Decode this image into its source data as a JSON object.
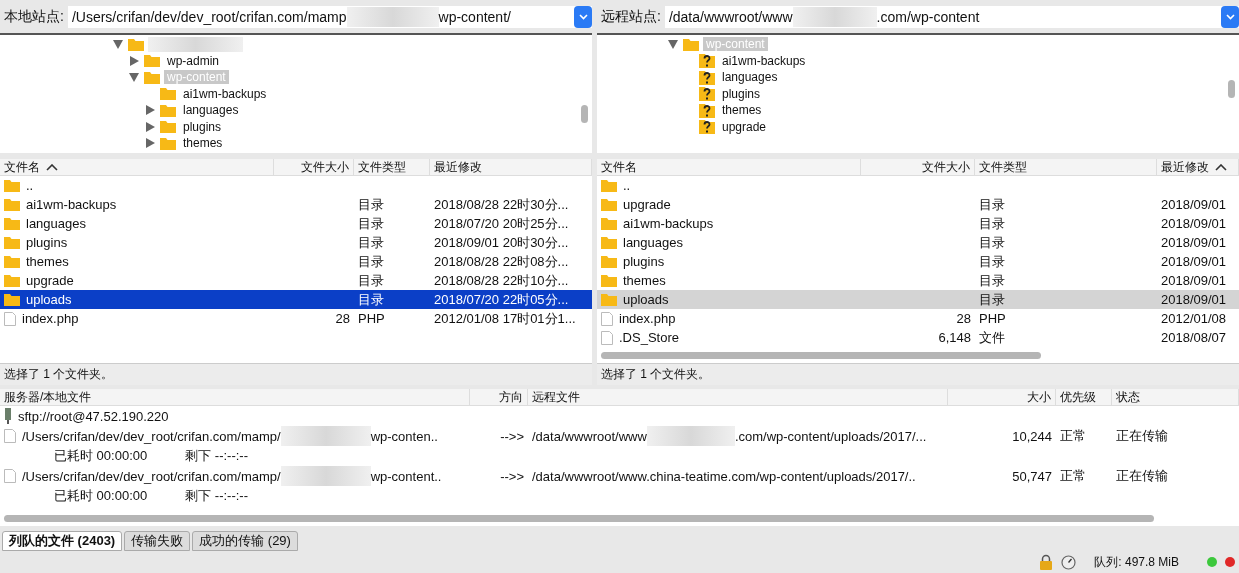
{
  "local": {
    "site_label": "本地站点:",
    "path": [
      {
        "kind": "text",
        "text": "/Users/crifan/dev/dev_root/crifan.com/mamp"
      },
      {
        "kind": "redacted"
      },
      {
        "kind": "text",
        "text": "wp-content/"
      }
    ],
    "tree": [
      {
        "kind": "redacted",
        "expanded": true,
        "children": [
          {
            "kind": "folder",
            "name": "wp-admin",
            "expanded": false,
            "selected": false
          },
          {
            "kind": "folder",
            "name": "wp-content",
            "expanded": true,
            "selected": true,
            "children": [
              {
                "kind": "leaf",
                "name": "ai1wm-backups",
                "selected": false
              },
              {
                "kind": "folder",
                "name": "languages",
                "expanded": false,
                "selected": false
              },
              {
                "kind": "folder",
                "name": "plugins",
                "expanded": false,
                "selected": false
              },
              {
                "kind": "folder",
                "name": "themes",
                "expanded": false,
                "selected": false
              }
            ]
          }
        ]
      }
    ],
    "focused": true,
    "columns": [
      {
        "label": "文件名",
        "sorted": true
      },
      {
        "label": "文件大小",
        "sorted": false
      },
      {
        "label": "文件类型",
        "sorted": false
      },
      {
        "label": "最近修改",
        "sorted": false
      }
    ],
    "rows": [
      {
        "kind": "folder",
        "name": "..",
        "selected": false
      },
      {
        "kind": "folder",
        "name": "ai1wm-backups",
        "type": "目录",
        "modified": "2018/08/28 22时30分...",
        "selected": false
      },
      {
        "kind": "folder",
        "name": "languages",
        "type": "目录",
        "modified": "2018/07/20 20时25分...",
        "selected": false
      },
      {
        "kind": "folder",
        "name": "plugins",
        "type": "目录",
        "modified": "2018/09/01 20时30分...",
        "selected": false
      },
      {
        "kind": "folder",
        "name": "themes",
        "type": "目录",
        "modified": "2018/08/28 22时08分...",
        "selected": false
      },
      {
        "kind": "folder",
        "name": "upgrade",
        "type": "目录",
        "modified": "2018/08/28 22时10分...",
        "selected": false
      },
      {
        "kind": "folder",
        "name": "uploads",
        "type": "目录",
        "modified": "2018/07/20 22时05分...",
        "selected": true
      },
      {
        "kind": "file",
        "name": "index.php",
        "size": "28",
        "type": "PHP",
        "modified": "2012/01/08 17时01分1...",
        "selected": false
      }
    ],
    "status": "选择了 1 个文件夹。"
  },
  "remote": {
    "site_label": "远程站点:",
    "path": [
      {
        "kind": "text",
        "text": "/data/wwwroot/www"
      },
      {
        "kind": "redacted"
      },
      {
        "kind": "text",
        "text": ".com/wp-content"
      }
    ],
    "tree": [
      {
        "kind": "folder",
        "name": "wp-content",
        "expanded": true,
        "selected": true,
        "children": [
          {
            "kind": "unknown",
            "name": "ai1wm-backups",
            "selected": false
          },
          {
            "kind": "unknown",
            "name": "languages",
            "selected": false
          },
          {
            "kind": "unknown",
            "name": "plugins",
            "selected": false
          },
          {
            "kind": "unknown",
            "name": "themes",
            "selected": false
          },
          {
            "kind": "unknown",
            "name": "upgrade",
            "selected": false
          }
        ]
      }
    ],
    "focused": false,
    "columns": [
      {
        "label": "文件名",
        "sorted": false
      },
      {
        "label": "文件大小",
        "sorted": false
      },
      {
        "label": "文件类型",
        "sorted": false
      },
      {
        "label": "最近修改",
        "sorted": true
      }
    ],
    "rows": [
      {
        "kind": "folder",
        "name": "..",
        "selected": false
      },
      {
        "kind": "folder",
        "name": "upgrade",
        "type": "目录",
        "modified": "2018/09/01",
        "selected": false
      },
      {
        "kind": "folder",
        "name": "ai1wm-backups",
        "type": "目录",
        "modified": "2018/09/01",
        "selected": false
      },
      {
        "kind": "folder",
        "name": "languages",
        "type": "目录",
        "modified": "2018/09/01",
        "selected": false
      },
      {
        "kind": "folder",
        "name": "plugins",
        "type": "目录",
        "modified": "2018/09/01",
        "selected": false
      },
      {
        "kind": "folder",
        "name": "themes",
        "type": "目录",
        "modified": "2018/09/01",
        "selected": false
      },
      {
        "kind": "folder",
        "name": "uploads",
        "type": "目录",
        "modified": "2018/09/01",
        "selected": true
      },
      {
        "kind": "file",
        "name": "index.php",
        "size": "28",
        "type": "PHP",
        "modified": "2012/01/08",
        "selected": false
      },
      {
        "kind": "file",
        "name": ".DS_Store",
        "size": "6,148",
        "type": "文件",
        "modified": "2018/08/07",
        "selected": false
      }
    ],
    "status": "选择了 1 个文件夹。"
  },
  "queue": {
    "columns": [
      "服务器/本地文件",
      "方向",
      "远程文件",
      "大小",
      "优先级",
      "状态"
    ],
    "server": "sftp://root@47.52.190.220",
    "transfers": [
      {
        "local": [
          {
            "kind": "text",
            "text": "/Users/crifan/dev/dev_root/crifan.com/mamp/"
          },
          {
            "kind": "redacted"
          },
          {
            "kind": "text",
            "text": "wp-conten.."
          }
        ],
        "direction": "-->>",
        "remote": [
          {
            "kind": "text",
            "text": "/data/wwwroot/www"
          },
          {
            "kind": "redacted"
          },
          {
            "kind": "text",
            "text": ".com/wp-content/uploads/2017/..."
          }
        ],
        "size": "10,244",
        "priority": "正常",
        "status": "正在传输",
        "elapsed": "已耗时 00:00:00",
        "remaining": "剩下 --:--:--"
      },
      {
        "local": [
          {
            "kind": "text",
            "text": "/Users/crifan/dev/dev_root/crifan.com/mamp/"
          },
          {
            "kind": "redacted"
          },
          {
            "kind": "text",
            "text": "wp-content.."
          }
        ],
        "direction": "-->>",
        "remote": [
          {
            "kind": "text",
            "text": "/data/wwwroot/www.china-teatime.com/wp-content/uploads/2017/.."
          }
        ],
        "size": "50,747",
        "priority": "正常",
        "status": "正在传输",
        "elapsed": "已耗时 00:00:00",
        "remaining": "剩下 --:--:--"
      }
    ]
  },
  "tabs": [
    {
      "label": "列队的文件 (2403)",
      "selected": true
    },
    {
      "label": "传输失败",
      "selected": false
    },
    {
      "label": "成功的传输 (29)",
      "selected": false
    }
  ],
  "status_bar": {
    "queue": "队列: 497.8 MiB",
    "lights": [
      {
        "color": "#3cc83c"
      },
      {
        "color": "#e02828"
      }
    ]
  }
}
